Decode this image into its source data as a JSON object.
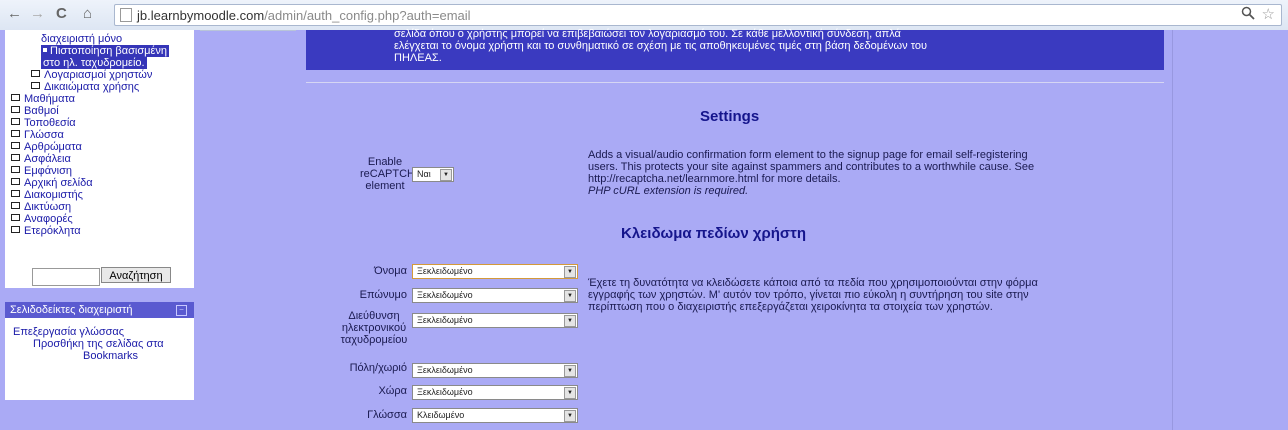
{
  "browser": {
    "back": "←",
    "forward": "→",
    "reload": "C",
    "home": "⌂",
    "url_host": "jb.learnbymoodle.com",
    "url_path": "/admin/auth_config.php?auth=email",
    "zoom_icon": "magnifier-icon",
    "star_icon": "star-icon"
  },
  "sidebar": {
    "items": [
      {
        "label": "διαχειριστή μόνο"
      },
      {
        "label": "Πιστοποίηση βασισμένη"
      },
      {
        "label": "στο ηλ. ταχυδρομείο."
      },
      {
        "label": "Λογαριασμοί χρηστών"
      },
      {
        "label": "Δικαιώματα χρήσης"
      },
      {
        "label": "Μαθήματα"
      },
      {
        "label": "Βαθμοί"
      },
      {
        "label": "Τοποθεσία"
      },
      {
        "label": "Γλώσσα"
      },
      {
        "label": "Αρθρώματα"
      },
      {
        "label": "Ασφάλεια"
      },
      {
        "label": "Εμφάνιση"
      },
      {
        "label": "Αρχική σελίδα"
      },
      {
        "label": "Διακομιστής"
      },
      {
        "label": "Δικτύωση"
      },
      {
        "label": "Αναφορές"
      },
      {
        "label": "Ετερόκλητα"
      }
    ],
    "search_value": "",
    "search_button": "Αναζήτηση"
  },
  "bookmarks": {
    "title": "Σελιδοδείκτες διαχειριστή",
    "collapse": "−",
    "edit_link": "Επεξεργασία γλώσσας",
    "add_link_1": "Προσθήκη της σελίδας στα",
    "add_link_2": "Bookmarks"
  },
  "description": {
    "line1": "σελίδα όπου ο χρήστης μπορεί να επιβεβαιώσει τον λογαριασμό του. Σε κάθε μελλοντική σύνδεση, απλά",
    "line2": "ελέγχεται το όνομα χρήστη και το συνθηματικό σε σχέση με τις αποθηκευμένες τιμές στη βάση δεδομένων του",
    "line3": "ΠΗΛΕΑΣ."
  },
  "settings": {
    "heading": "Settings",
    "recaptcha": {
      "label_1": "Enable",
      "label_2": "reCAPTCHA",
      "label_3": "element",
      "value": "Ναι",
      "help_1": "Adds a visual/audio confirmation form element to the signup page for email self-registering",
      "help_2": "users. This protects your site against spammers and contributes to a worthwhile cause. See",
      "help_3": "http://recaptcha.net/learnmore.html for more details.",
      "help_4": "PHP cURL extension is required."
    }
  },
  "lock": {
    "heading": "Κλειδωμα πεδίων χρήστη",
    "help_1": "Έχετε τη δυνατότητα να κλειδώσετε κάποια από τα πεδία που χρησιμοποιούνται στην φόρμα",
    "help_2": "εγγραφής των χρηστών. Μ' αυτόν τον τρόπο, γίνεται πιο εύκολη η συντήρηση του site στην",
    "help_3": "περίπτωση που ο διαχειριστής επεξεργάζεται χειροκίνητα τα στοιχεία των χρηστών.",
    "fields": [
      {
        "label": "Όνομα",
        "value": "Ξεκλειδωμένο"
      },
      {
        "label": "Επώνυμο",
        "value": "Ξεκλειδωμένο"
      },
      {
        "label_1": "Διεύθυνση",
        "label_2": "ηλεκτρονικού",
        "label_3": "ταχυδρομείου",
        "value": "Ξεκλειδωμένο"
      },
      {
        "label": "Πόλη/χωριό",
        "value": "Ξεκλειδωμένο"
      },
      {
        "label": "Χώρα",
        "value": "Ξεκλειδωμένο"
      },
      {
        "label": "Γλώσσα",
        "value": "Κλειδωμένο"
      }
    ]
  },
  "colors": {
    "page_bg": "#aaaaf5",
    "description_bg": "#3a3ac0",
    "heading": "#15158c",
    "link": "#1a1aa8"
  }
}
